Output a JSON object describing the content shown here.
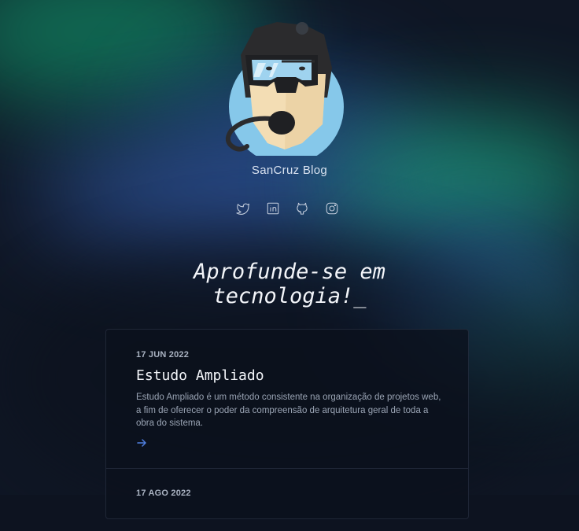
{
  "site": {
    "title": "SanCruz Blog"
  },
  "social": [
    {
      "name": "twitter",
      "icon": "twitter-icon"
    },
    {
      "name": "linkedin",
      "icon": "linkedin-icon"
    },
    {
      "name": "github",
      "icon": "github-icon"
    },
    {
      "name": "instagram",
      "icon": "instagram-icon"
    }
  ],
  "hero": {
    "line1": "Aprofunde-se em",
    "line2": "tecnologia!",
    "cursor": "_"
  },
  "posts": [
    {
      "date": "17 JUN 2022",
      "title": "Estudo Ampliado",
      "excerpt": "Estudo Ampliado é um método consistente na organização de projetos web, a fim de oferecer o poder da compreensão de arquitetura geral de toda a obra do sistema."
    },
    {
      "date": "17 AGO 2022"
    }
  ],
  "colors": {
    "accent": "#4f7fe0",
    "text": "#f4f6fa",
    "muted": "#9aa4b4",
    "background": "#0d1320"
  }
}
